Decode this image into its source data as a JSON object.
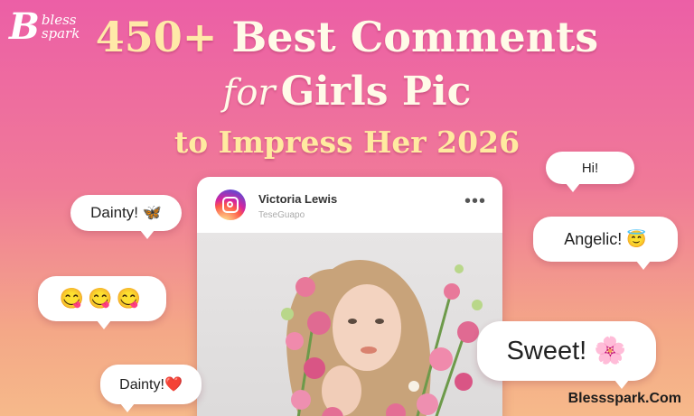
{
  "logo": {
    "mark": "B",
    "line1": "bless",
    "line2": "spark"
  },
  "headline": {
    "number": "450+",
    "line1_rest": "Best Comments",
    "for": "for",
    "line2_rest": "Girls Pic",
    "line3": "to Impress Her 2026"
  },
  "post": {
    "user_name": "Victoria Lewis",
    "user_sub": "TeseGuapo",
    "more": "•••"
  },
  "bubbles": {
    "dainty1": "Dainty! 🦋",
    "emoji": "😋😋😋",
    "dainty2": "Dainty!❤️",
    "hi": "Hi!",
    "angelic": "Angelic! 😇",
    "sweet": "Sweet! 🌸"
  },
  "site": "Blessspark.Com",
  "colors": {
    "bg_top": "#ec5fa6",
    "bg_bottom": "#f6b98a",
    "headline": "#fffbe8",
    "headline_accent": "#ffe9a8"
  }
}
